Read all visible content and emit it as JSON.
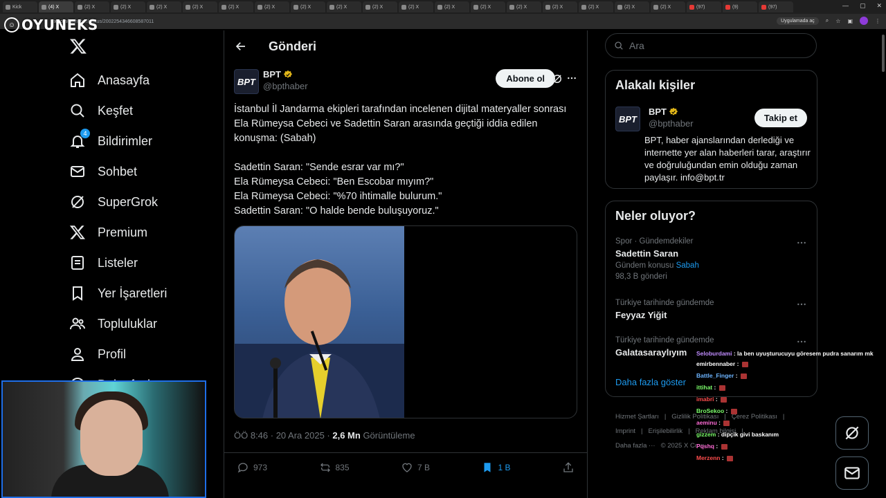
{
  "browser": {
    "tabs": [
      "Kick",
      "(4) X",
      "(2) X",
      "(2) X",
      "(2) X",
      "(2) X",
      "(2) X",
      "(2) X",
      "(2) X",
      "(2) X",
      "(2) X",
      "(2) X",
      "(2) X",
      "(2) X",
      "(2) X",
      "(2) X",
      "(2) X",
      "(2) X",
      "(2) X",
      "(97)",
      "(9)",
      "(97)"
    ],
    "url_host": "x.com",
    "url_path": "/bpthaber/status/2002254346608587011",
    "open_in_app": "Uygulamada aç"
  },
  "watermark": {
    "text": "OYUNEKS"
  },
  "nav": {
    "items": [
      {
        "label": "Anasayfa",
        "icon": "home-icon"
      },
      {
        "label": "Keşfet",
        "icon": "search-icon"
      },
      {
        "label": "Bildirimler",
        "icon": "bell-icon",
        "badge": "4"
      },
      {
        "label": "Sohbet",
        "icon": "mail-icon"
      },
      {
        "label": "SuperGrok",
        "icon": "grok-icon"
      },
      {
        "label": "Premium",
        "icon": "x-icon"
      },
      {
        "label": "Listeler",
        "icon": "list-icon"
      },
      {
        "label": "Yer İşaretleri",
        "icon": "bookmark-icon"
      },
      {
        "label": "Topluluklar",
        "icon": "people-icon"
      },
      {
        "label": "Profil",
        "icon": "person-icon"
      },
      {
        "label": "Daha fazla",
        "icon": "more-circle-icon"
      }
    ]
  },
  "main": {
    "title": "Gönderi",
    "post": {
      "author_name": "BPT",
      "author_handle": "@bpthaber",
      "avatar_text": "BPT",
      "subscribe_label": "Abone ol",
      "text_intro": "İstanbul İl Jandarma ekipleri tarafından incelenen dijital materyaller sonrası Ela Rümeysa Cebeci ve Sadettin Saran arasında geçtiği iddia edilen konuşma: (Sabah)",
      "quotes": [
        "Sadettin Saran: \"Sende esrar var mı?\"",
        "Ela Rümeysa Cebeci: \"Ben Escobar mıyım?\"",
        "Ela Rümeysa Cebeci: \"%70 ihtimalle bulurum.\"",
        "Sadettin Saran: \"O halde bende buluşuyoruz.\""
      ],
      "time": "ÖÖ 8:46 · 20 Ara 2025 · ",
      "views_value": "2,6 Mn",
      "views_label": " Görüntüleme",
      "replies": "973",
      "reposts": "835",
      "likes": "7 B",
      "bookmarks": "1 B"
    }
  },
  "right": {
    "search_placeholder": "Ara",
    "related_title": "Alakalı kişiler",
    "related": {
      "name": "BPT",
      "handle": "@bpthaber",
      "avatar_text": "BPT",
      "follow_label": "Takip et",
      "bio": "BPT, haber ajanslarından derlediği ve internette yer alan haberleri tarar, araştırır ve doğruluğundan emin olduğu zaman paylaşır. info@bpt.tr"
    },
    "trends_title": "Neler oluyor?",
    "trends": [
      {
        "category": "Spor · Gündemdekiler",
        "name": "Sadettin Saran",
        "sub_prefix": "Gündem konusu ",
        "sub_link": "Sabah",
        "posts": "98,3 B gönderi"
      },
      {
        "category": "Türkiye tarihinde gündemde",
        "name": "Feyyaz Yiğit"
      },
      {
        "category": "Türkiye tarihinde gündemde",
        "name": "Galatasaraylıyım"
      }
    ],
    "show_more": "Daha fazla göster",
    "footer": [
      "Hizmet Şartları",
      "|",
      "Gizlilik Politikası",
      "|",
      "Çerez Politikası",
      "|",
      "Imprint",
      "|",
      "Erişilebilirlik",
      "|",
      "Reklam bilgisi",
      "|",
      "Daha fazla ···",
      "© 2025 X Corp."
    ]
  },
  "chat": [
    {
      "user": "Seloburdami",
      "color": "#c08cff",
      "msg": "la ben uyuşturucuyu göresem pudra sanarım mk"
    },
    {
      "user": "emirbennaber",
      "color": "#ffffff",
      "msg": ""
    },
    {
      "user": "Battle_Finger",
      "color": "#6cb4ff",
      "msg": ""
    },
    {
      "user": "ittihat",
      "color": "#7cff6b",
      "msg": ""
    },
    {
      "user": "imabri",
      "color": "#ff4d4d",
      "msg": ""
    },
    {
      "user": "BroSekoo",
      "color": "#7cff6b",
      "msg": ""
    },
    {
      "user": "aeminu",
      "color": "#ff6bd6",
      "msg": ""
    },
    {
      "user": "gizzem",
      "color": "#7cff6b",
      "msg": "dipçik givi baskanım"
    },
    {
      "user": "Pqshq",
      "color": "#ff6bd6",
      "msg": ""
    },
    {
      "user": "Merzenn",
      "color": "#ff4d4d",
      "msg": ""
    }
  ],
  "colors": {
    "accent": "#1d9bf0",
    "border": "#2f3336",
    "muted": "#71767b",
    "verified": "#e2b719"
  }
}
